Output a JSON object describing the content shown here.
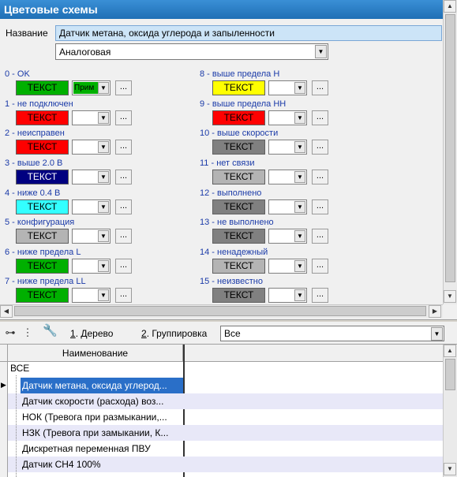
{
  "window": {
    "title": "Цветовые схемы"
  },
  "name_field": {
    "label": "Название",
    "value": "Датчик метана, оксида углерода и запыленности"
  },
  "type_select": {
    "value": "Аналоговая"
  },
  "states": [
    {
      "label": "0 - OK",
      "swatch_text": "ТЕКСТ",
      "swatch_color": "#00b000",
      "text_color": "#000000",
      "combo_text": "Прим",
      "combo_color": "#00b000"
    },
    {
      "label": "1 - не подключен",
      "swatch_text": "ТЕКСТ",
      "swatch_color": "#ff0000",
      "text_color": "#000000",
      "combo_text": "",
      "combo_color": "#ffffff"
    },
    {
      "label": "2 - неисправен",
      "swatch_text": "ТЕКСТ",
      "swatch_color": "#ff0000",
      "text_color": "#000000",
      "combo_text": "",
      "combo_color": "#ffffff"
    },
    {
      "label": "3 - выше 2.0 В",
      "swatch_text": "ТЕКСТ",
      "swatch_color": "#000080",
      "text_color": "#ffffff",
      "combo_text": "",
      "combo_color": "#ffffff"
    },
    {
      "label": "4 - ниже 0.4 В",
      "swatch_text": "ТЕКСТ",
      "swatch_color": "#33ffff",
      "text_color": "#000000",
      "combo_text": "",
      "combo_color": "#ffffff"
    },
    {
      "label": "5 - конфигурация",
      "swatch_text": "ТЕКСТ",
      "swatch_color": "#b4b4b4",
      "text_color": "#000000",
      "combo_text": "",
      "combo_color": "#ffffff"
    },
    {
      "label": "6 - ниже предела L",
      "swatch_text": "ТЕКСТ",
      "swatch_color": "#00b000",
      "text_color": "#000000",
      "combo_text": "",
      "combo_color": "#ffffff"
    },
    {
      "label": "7 - ниже предела LL",
      "swatch_text": "ТЕКСТ",
      "swatch_color": "#00b000",
      "text_color": "#000000",
      "combo_text": "",
      "combo_color": "#ffffff"
    },
    {
      "label": "8 - выше предела H",
      "swatch_text": "ТЕКСТ",
      "swatch_color": "#ffff00",
      "text_color": "#000000",
      "combo_text": "",
      "combo_color": "#ffffff"
    },
    {
      "label": "9 - выше предела HH",
      "swatch_text": "ТЕКСТ",
      "swatch_color": "#ff0000",
      "text_color": "#000000",
      "combo_text": "",
      "combo_color": "#ffffff"
    },
    {
      "label": "10 - выше скорости",
      "swatch_text": "ТЕКСТ",
      "swatch_color": "#808080",
      "text_color": "#000000",
      "combo_text": "",
      "combo_color": "#ffffff"
    },
    {
      "label": "11 - нет связи",
      "swatch_text": "ТЕКСТ",
      "swatch_color": "#b4b4b4",
      "text_color": "#000000",
      "combo_text": "",
      "combo_color": "#ffffff"
    },
    {
      "label": "12 - выполнено",
      "swatch_text": "ТЕКСТ",
      "swatch_color": "#808080",
      "text_color": "#000000",
      "combo_text": "",
      "combo_color": "#ffffff"
    },
    {
      "label": "13 - не выполнено",
      "swatch_text": "ТЕКСТ",
      "swatch_color": "#808080",
      "text_color": "#000000",
      "combo_text": "",
      "combo_color": "#ffffff"
    },
    {
      "label": "14 - ненадежный",
      "swatch_text": "ТЕКСТ",
      "swatch_color": "#b4b4b4",
      "text_color": "#000000",
      "combo_text": "",
      "combo_color": "#ffffff"
    },
    {
      "label": "15 - неизвестно",
      "swatch_text": "ТЕКСТ",
      "swatch_color": "#808080",
      "text_color": "#000000",
      "combo_text": "",
      "combo_color": "#ffffff"
    }
  ],
  "toolbar": {
    "tree_key": "1",
    "tree_label": ". Дерево",
    "group_key": "2",
    "group_label": ". Группировка",
    "group_select_value": "Все"
  },
  "grid": {
    "header": "Наименование",
    "root": "ВСЕ",
    "rows": [
      {
        "text": "Датчик метана, оксида углерод...",
        "selected": true
      },
      {
        "text": "Датчик скорости (расхода) воз...",
        "selected": false
      },
      {
        "text": "НОК (Тревога при размыкании,...",
        "selected": false
      },
      {
        "text": "НЗК (Тревога при замыкании, К...",
        "selected": false
      },
      {
        "text": "Дискретная переменная ПВУ",
        "selected": false
      },
      {
        "text": "Датчик СН4 100%",
        "selected": false
      }
    ]
  },
  "colors": {
    "title_bar": "#1f6fb5",
    "selection": "#2a6fc8",
    "alt_row": "#e8e8f8",
    "label_blue": "#1a3aa8"
  }
}
